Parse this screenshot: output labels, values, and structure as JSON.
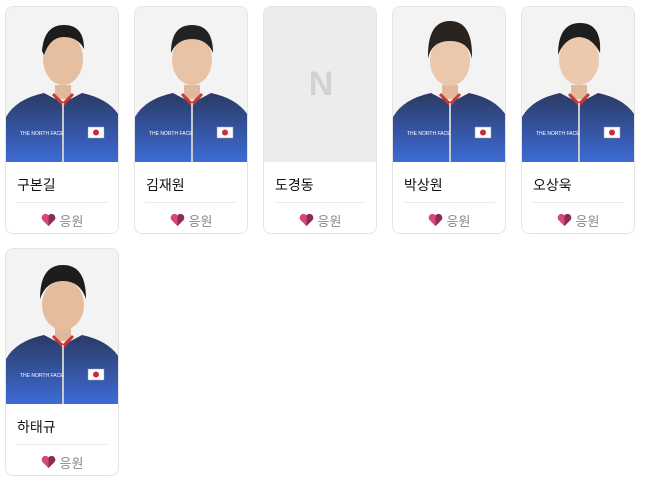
{
  "players": [
    {
      "name": "구본길",
      "cheer_label": "응원",
      "has_photo": true
    },
    {
      "name": "김재원",
      "cheer_label": "응원",
      "has_photo": true
    },
    {
      "name": "도경동",
      "cheer_label": "응원",
      "has_photo": false
    },
    {
      "name": "박상원",
      "cheer_label": "응원",
      "has_photo": true
    },
    {
      "name": "오상욱",
      "cheer_label": "응원",
      "has_photo": true
    },
    {
      "name": "하태규",
      "cheer_label": "응원",
      "has_photo": true
    }
  ],
  "placeholder_logo": "N",
  "colors": {
    "jacket_top": "#2b3a64",
    "jacket_bottom": "#3d6bd6",
    "heart_left": "#d6487a",
    "heart_right": "#8d2a55",
    "placeholder_bg": "#ececec"
  }
}
